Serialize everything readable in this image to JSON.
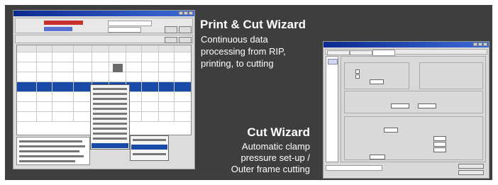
{
  "features": [
    {
      "title": "Print & Cut Wizard",
      "description": "Continuous data\nprocessing from RIP,\nprinting, to cutting"
    },
    {
      "title": "Cut Wizard",
      "description": "Automatic clamp\npressure set-up /\nOuter frame cutting"
    }
  ],
  "colors": {
    "panel_background": "#3e3e3e",
    "heading_text": "#ffffff",
    "selection_highlight": "#1a4aa8",
    "titlebar": "#1d3fa8"
  }
}
